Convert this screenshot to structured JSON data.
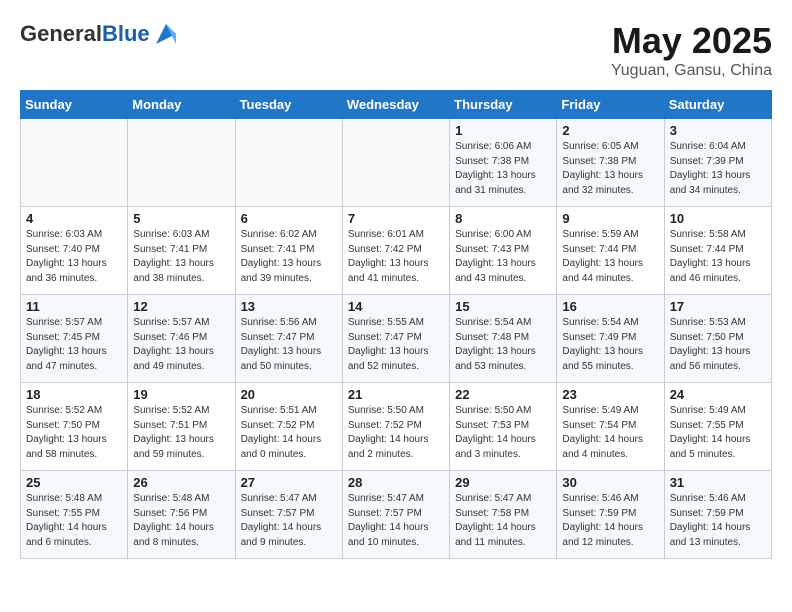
{
  "header": {
    "logo_general": "General",
    "logo_blue": "Blue",
    "month_title": "May 2025",
    "subtitle": "Yuguan, Gansu, China"
  },
  "weekdays": [
    "Sunday",
    "Monday",
    "Tuesday",
    "Wednesday",
    "Thursday",
    "Friday",
    "Saturday"
  ],
  "weeks": [
    [
      {
        "day": "",
        "info": ""
      },
      {
        "day": "",
        "info": ""
      },
      {
        "day": "",
        "info": ""
      },
      {
        "day": "",
        "info": ""
      },
      {
        "day": "1",
        "info": "Sunrise: 6:06 AM\nSunset: 7:38 PM\nDaylight: 13 hours\nand 31 minutes."
      },
      {
        "day": "2",
        "info": "Sunrise: 6:05 AM\nSunset: 7:38 PM\nDaylight: 13 hours\nand 32 minutes."
      },
      {
        "day": "3",
        "info": "Sunrise: 6:04 AM\nSunset: 7:39 PM\nDaylight: 13 hours\nand 34 minutes."
      }
    ],
    [
      {
        "day": "4",
        "info": "Sunrise: 6:03 AM\nSunset: 7:40 PM\nDaylight: 13 hours\nand 36 minutes."
      },
      {
        "day": "5",
        "info": "Sunrise: 6:03 AM\nSunset: 7:41 PM\nDaylight: 13 hours\nand 38 minutes."
      },
      {
        "day": "6",
        "info": "Sunrise: 6:02 AM\nSunset: 7:41 PM\nDaylight: 13 hours\nand 39 minutes."
      },
      {
        "day": "7",
        "info": "Sunrise: 6:01 AM\nSunset: 7:42 PM\nDaylight: 13 hours\nand 41 minutes."
      },
      {
        "day": "8",
        "info": "Sunrise: 6:00 AM\nSunset: 7:43 PM\nDaylight: 13 hours\nand 43 minutes."
      },
      {
        "day": "9",
        "info": "Sunrise: 5:59 AM\nSunset: 7:44 PM\nDaylight: 13 hours\nand 44 minutes."
      },
      {
        "day": "10",
        "info": "Sunrise: 5:58 AM\nSunset: 7:44 PM\nDaylight: 13 hours\nand 46 minutes."
      }
    ],
    [
      {
        "day": "11",
        "info": "Sunrise: 5:57 AM\nSunset: 7:45 PM\nDaylight: 13 hours\nand 47 minutes."
      },
      {
        "day": "12",
        "info": "Sunrise: 5:57 AM\nSunset: 7:46 PM\nDaylight: 13 hours\nand 49 minutes."
      },
      {
        "day": "13",
        "info": "Sunrise: 5:56 AM\nSunset: 7:47 PM\nDaylight: 13 hours\nand 50 minutes."
      },
      {
        "day": "14",
        "info": "Sunrise: 5:55 AM\nSunset: 7:47 PM\nDaylight: 13 hours\nand 52 minutes."
      },
      {
        "day": "15",
        "info": "Sunrise: 5:54 AM\nSunset: 7:48 PM\nDaylight: 13 hours\nand 53 minutes."
      },
      {
        "day": "16",
        "info": "Sunrise: 5:54 AM\nSunset: 7:49 PM\nDaylight: 13 hours\nand 55 minutes."
      },
      {
        "day": "17",
        "info": "Sunrise: 5:53 AM\nSunset: 7:50 PM\nDaylight: 13 hours\nand 56 minutes."
      }
    ],
    [
      {
        "day": "18",
        "info": "Sunrise: 5:52 AM\nSunset: 7:50 PM\nDaylight: 13 hours\nand 58 minutes."
      },
      {
        "day": "19",
        "info": "Sunrise: 5:52 AM\nSunset: 7:51 PM\nDaylight: 13 hours\nand 59 minutes."
      },
      {
        "day": "20",
        "info": "Sunrise: 5:51 AM\nSunset: 7:52 PM\nDaylight: 14 hours\nand 0 minutes."
      },
      {
        "day": "21",
        "info": "Sunrise: 5:50 AM\nSunset: 7:52 PM\nDaylight: 14 hours\nand 2 minutes."
      },
      {
        "day": "22",
        "info": "Sunrise: 5:50 AM\nSunset: 7:53 PM\nDaylight: 14 hours\nand 3 minutes."
      },
      {
        "day": "23",
        "info": "Sunrise: 5:49 AM\nSunset: 7:54 PM\nDaylight: 14 hours\nand 4 minutes."
      },
      {
        "day": "24",
        "info": "Sunrise: 5:49 AM\nSunset: 7:55 PM\nDaylight: 14 hours\nand 5 minutes."
      }
    ],
    [
      {
        "day": "25",
        "info": "Sunrise: 5:48 AM\nSunset: 7:55 PM\nDaylight: 14 hours\nand 6 minutes."
      },
      {
        "day": "26",
        "info": "Sunrise: 5:48 AM\nSunset: 7:56 PM\nDaylight: 14 hours\nand 8 minutes."
      },
      {
        "day": "27",
        "info": "Sunrise: 5:47 AM\nSunset: 7:57 PM\nDaylight: 14 hours\nand 9 minutes."
      },
      {
        "day": "28",
        "info": "Sunrise: 5:47 AM\nSunset: 7:57 PM\nDaylight: 14 hours\nand 10 minutes."
      },
      {
        "day": "29",
        "info": "Sunrise: 5:47 AM\nSunset: 7:58 PM\nDaylight: 14 hours\nand 11 minutes."
      },
      {
        "day": "30",
        "info": "Sunrise: 5:46 AM\nSunset: 7:59 PM\nDaylight: 14 hours\nand 12 minutes."
      },
      {
        "day": "31",
        "info": "Sunrise: 5:46 AM\nSunset: 7:59 PM\nDaylight: 14 hours\nand 13 minutes."
      }
    ]
  ]
}
